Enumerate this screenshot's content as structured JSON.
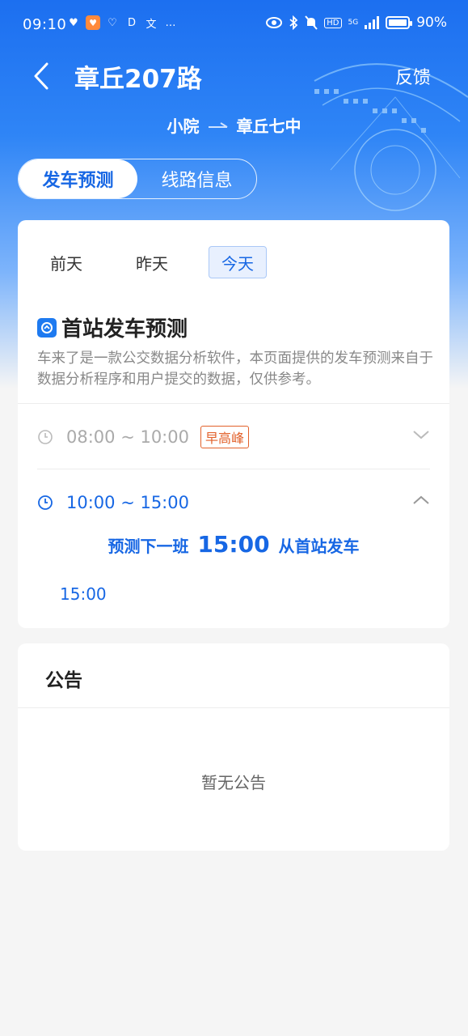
{
  "status_bar": {
    "time": "09:10",
    "battery_text": "90%",
    "battery_level": 0.9,
    "network_label": "5G",
    "hd_label": "HD"
  },
  "header": {
    "title": "章丘207路",
    "feedback_label": "反馈",
    "route_from": "小院",
    "route_to": "章丘七中"
  },
  "tabs": [
    {
      "label": "发车预测",
      "active": true
    },
    {
      "label": "线路信息",
      "active": false
    }
  ],
  "days": [
    {
      "label": "前天",
      "active": false
    },
    {
      "label": "昨天",
      "active": false
    },
    {
      "label": "今天",
      "active": true
    }
  ],
  "section": {
    "title": "首站发车预测",
    "description": "车来了是一款公交数据分析软件，本页面提供的发车预测来自于数据分析程序和用户提交的数据，仅供参考。"
  },
  "slots": [
    {
      "time_range": "08:00 ~ 10:00",
      "tag": "早高峰",
      "expanded": false
    },
    {
      "time_range": "10:00 ~ 15:00",
      "expanded": true
    }
  ],
  "prediction": {
    "prefix": "预测下一班",
    "time": "15:00",
    "suffix": "从首站发车",
    "departures": [
      "15:00"
    ]
  },
  "notice": {
    "title": "公告",
    "empty_text": "暂无公告"
  },
  "colors": {
    "primary": "#1767e4",
    "peak_tag": "#e2612b",
    "header_gradient_top": "#1c6ff0"
  }
}
